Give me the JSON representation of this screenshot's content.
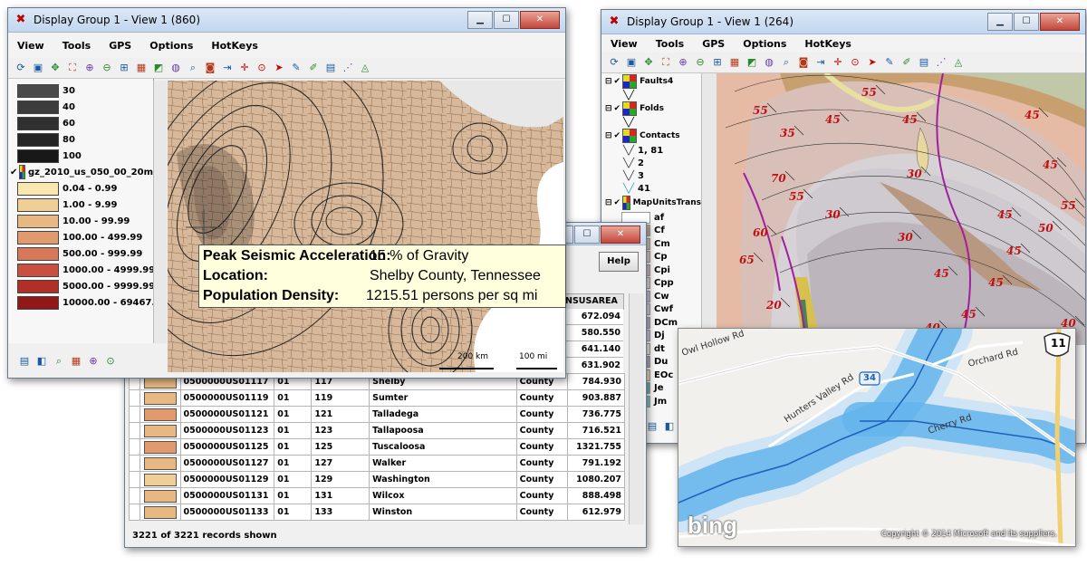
{
  "window1": {
    "title": "Display Group 1 - View 1 (860)",
    "menu": [
      "View",
      "Tools",
      "GPS",
      "Options",
      "HotKeys"
    ],
    "legend_top": [
      {
        "label": "30",
        "color": "#4a4a4a"
      },
      {
        "label": "40",
        "color": "#3c3c3c"
      },
      {
        "label": "60",
        "color": "#303030"
      },
      {
        "label": "80",
        "color": "#252525"
      },
      {
        "label": "100",
        "color": "#181818"
      }
    ],
    "layer_name": "gz_2010_us_050_00_20m",
    "legend_classes": [
      {
        "label": "0.04 - 0.99",
        "color": "#f8e8b0"
      },
      {
        "label": "1.00 - 9.99",
        "color": "#f0cf96"
      },
      {
        "label": "10.00 - 99.99",
        "color": "#e8b882"
      },
      {
        "label": "100.00 - 499.99",
        "color": "#e09a6e"
      },
      {
        "label": "500.00 - 999.99",
        "color": "#d8785a"
      },
      {
        "label": "1000.00 - 4999.99",
        "color": "#c85040"
      },
      {
        "label": "5000.00 - 9999.99",
        "color": "#b03028"
      },
      {
        "label": "10000.00 - 69467.",
        "color": "#901818"
      }
    ],
    "scale_km": "200 km",
    "scale_mi": "100 mi"
  },
  "tooltip": {
    "rows": [
      {
        "label": "Peak Seismic Acceleration:",
        "value": "15 % of Gravity"
      },
      {
        "label": "Location:",
        "value": "Shelby County, Tennessee"
      },
      {
        "label": "Population Density:",
        "value": "1215.51 persons per sq mi"
      }
    ]
  },
  "table_window": {
    "help_label": "Help",
    "column_header": "NSUSAREA",
    "top_values": [
      "672.094",
      "580.550",
      "641.140",
      "631.902"
    ],
    "rows": [
      {
        "id": "0500000US01117",
        "state": "01",
        "county": "117",
        "name": "Shelby",
        "lsad": "County",
        "area": "784.930",
        "color": "#e8b882"
      },
      {
        "id": "0500000US01119",
        "state": "01",
        "county": "119",
        "name": "Sumter",
        "lsad": "County",
        "area": "903.887",
        "color": "#e8b882"
      },
      {
        "id": "0500000US01121",
        "state": "01",
        "county": "121",
        "name": "Talladega",
        "lsad": "County",
        "area": "736.775",
        "color": "#e09a6e"
      },
      {
        "id": "0500000US01123",
        "state": "01",
        "county": "123",
        "name": "Tallapoosa",
        "lsad": "County",
        "area": "716.521",
        "color": "#e8b882"
      },
      {
        "id": "0500000US01125",
        "state": "01",
        "county": "125",
        "name": "Tuscaloosa",
        "lsad": "County",
        "area": "1321.755",
        "color": "#e09a6e"
      },
      {
        "id": "0500000US01127",
        "state": "01",
        "county": "127",
        "name": "Walker",
        "lsad": "County",
        "area": "791.192",
        "color": "#e8b882"
      },
      {
        "id": "0500000US01129",
        "state": "01",
        "county": "129",
        "name": "Washington",
        "lsad": "County",
        "area": "1080.207",
        "color": "#f0cf96"
      },
      {
        "id": "0500000US01131",
        "state": "01",
        "county": "131",
        "name": "Wilcox",
        "lsad": "County",
        "area": "888.498",
        "color": "#e8b882"
      },
      {
        "id": "0500000US01133",
        "state": "01",
        "county": "133",
        "name": "Winston",
        "lsad": "County",
        "area": "612.979",
        "color": "#e8b882"
      }
    ],
    "status": "3221 of 3221 records shown"
  },
  "window2": {
    "title": "Display Group 1 - View 1 (264)",
    "menu": [
      "View",
      "Tools",
      "GPS",
      "Options",
      "HotKeys"
    ],
    "layers": [
      {
        "name": "Faults4"
      },
      {
        "name": "Folds"
      },
      {
        "name": "Contacts",
        "items": [
          "1, 81",
          "2",
          "3",
          "41"
        ]
      },
      {
        "name": "MapUnitsTrans"
      }
    ],
    "units": [
      {
        "label": "af",
        "color": "#ffffff"
      },
      {
        "label": "Cf",
        "color": "#c8a890"
      },
      {
        "label": "Cm",
        "color": "#d8c0b0"
      },
      {
        "label": "Cp",
        "color": "#e0ccc0"
      },
      {
        "label": "Cpi",
        "color": "#d0b8c8"
      },
      {
        "label": "Cpp",
        "color": "#e8d8d0"
      },
      {
        "label": "Cw",
        "color": "#c8c0d0"
      },
      {
        "label": "Cwf",
        "color": "#d8d0d8"
      },
      {
        "label": "DCm",
        "color": "#b8b0c0"
      },
      {
        "label": "Dj",
        "color": "#c8c8d8"
      },
      {
        "label": "dt",
        "color": "#f0e8d8"
      },
      {
        "label": "Du",
        "color": "#b0a8b8"
      },
      {
        "label": "EOc",
        "color": "#e8d8b8"
      },
      {
        "label": "Je",
        "color": "#70b0b0"
      },
      {
        "label": "Jm",
        "color": "#80c0c0"
      }
    ],
    "dip_labels": [
      "55",
      "55",
      "45",
      "45",
      "35",
      "30",
      "45",
      "45",
      "45",
      "55",
      "70",
      "30",
      "55",
      "45",
      "50",
      "30",
      "45",
      "45",
      "20",
      "65",
      "45",
      "40",
      "45",
      "40",
      "60"
    ]
  },
  "bing_map": {
    "roads": [
      "Owl Hollow Rd",
      "Orchard Rd",
      "Hunters Valley Rd",
      "Cherry Rd"
    ],
    "shield_11": "11",
    "shield_34": "34",
    "logo": "bing",
    "copyright": "Copyright © 2014 Microsoft and its suppliers."
  }
}
